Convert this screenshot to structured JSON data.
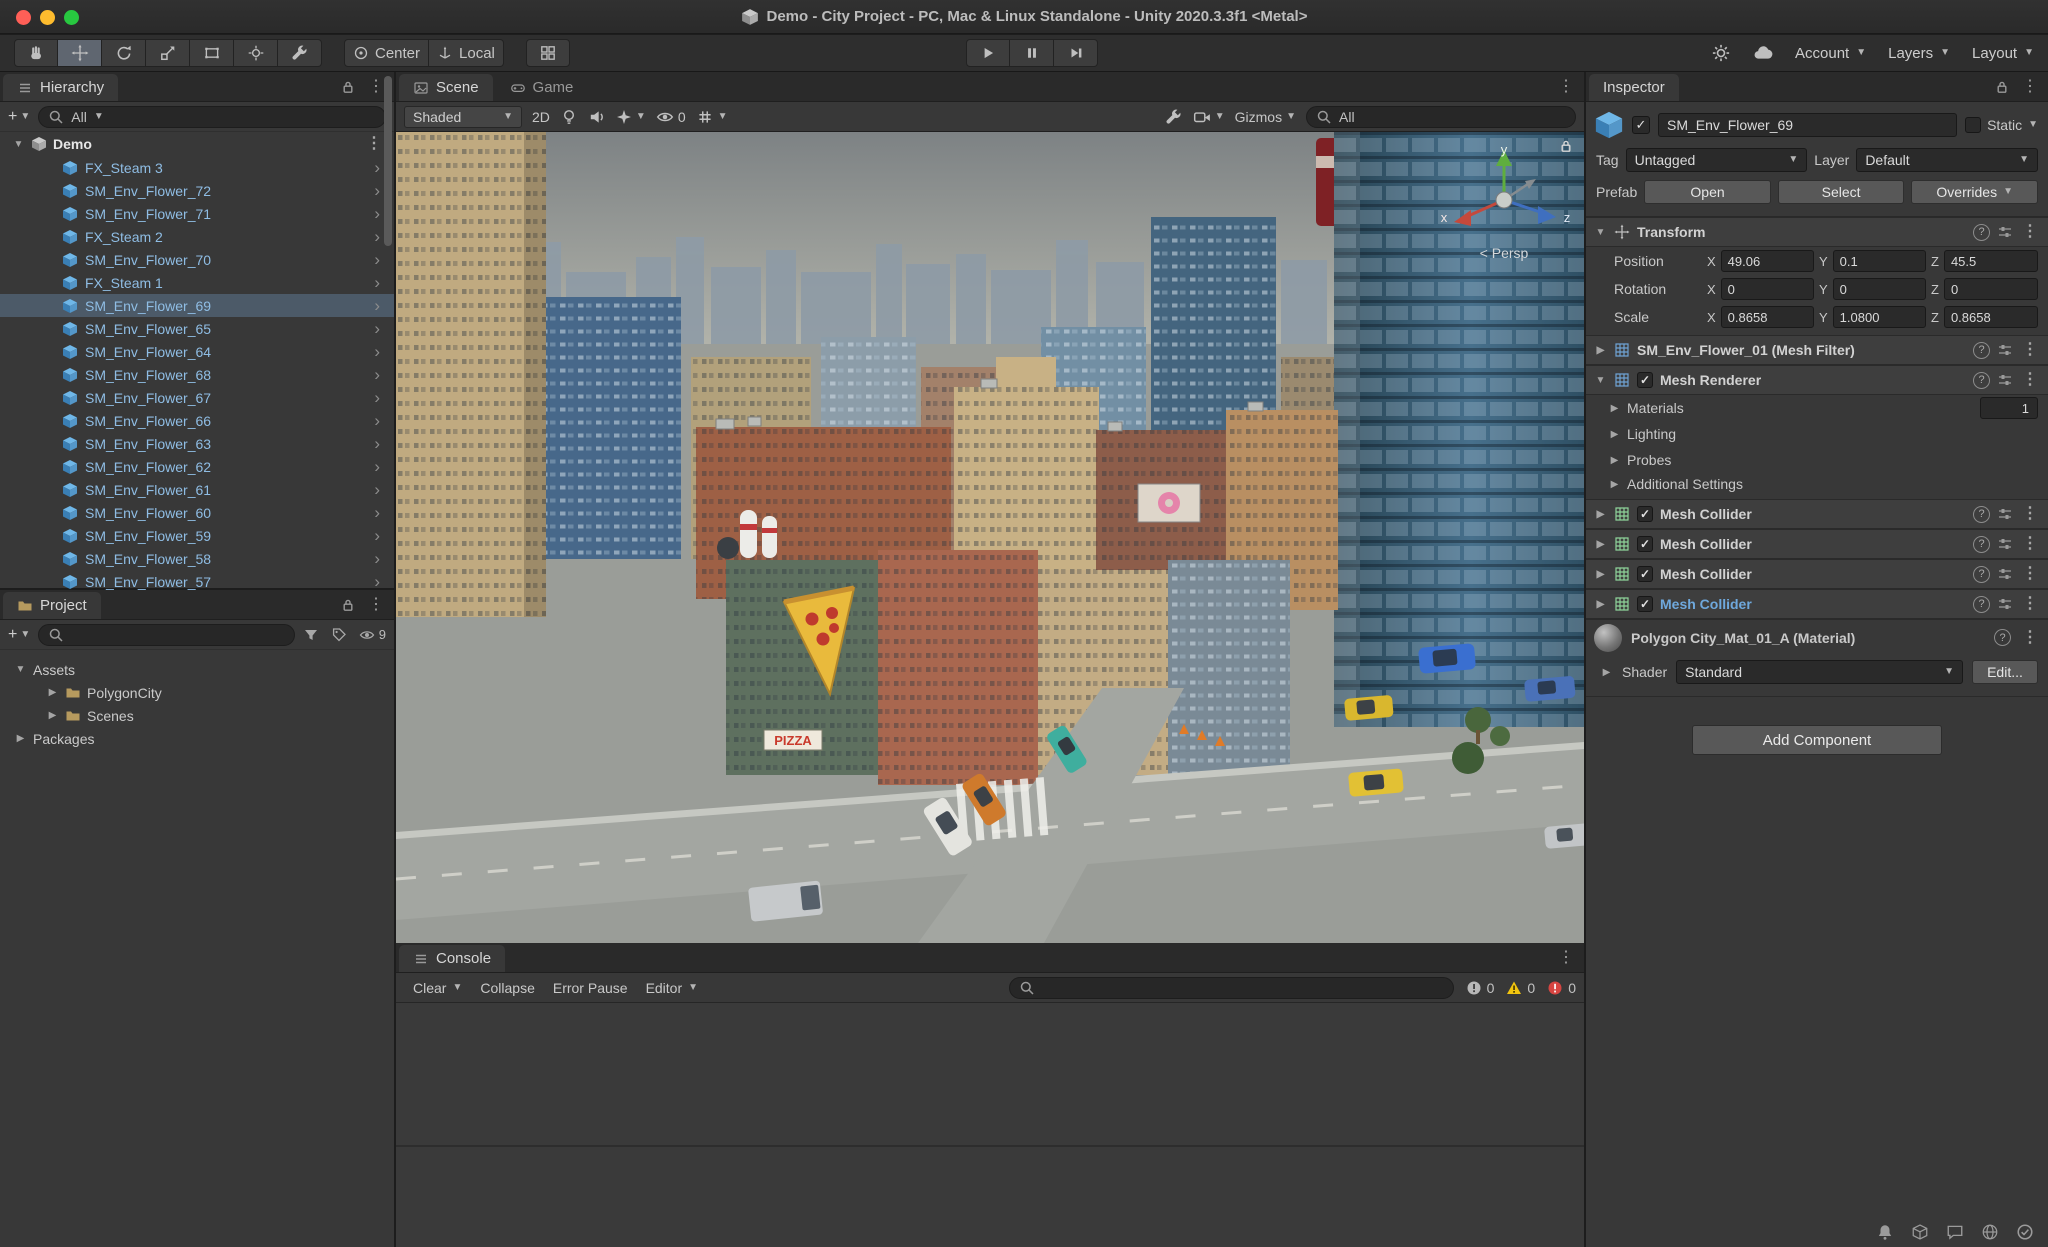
{
  "colors": {
    "selection_row": "#4c5a68",
    "prefab_text": "#8fbde4",
    "warning_yellow": "#f1c40f",
    "error_red": "#d64541",
    "panel_bg": "#383838",
    "accent_component": "#6fa8dc"
  },
  "titlebar": {
    "title": "Demo - City Project - PC, Mac & Linux Standalone - Unity 2020.3.3f1 <Metal>"
  },
  "toolbar": {
    "center_label": "Center",
    "local_label": "Local",
    "account_label": "Account",
    "layers_label": "Layers",
    "layout_label": "Layout"
  },
  "hierarchy": {
    "tab": "Hierarchy",
    "search_value": "All",
    "scene": "Demo",
    "items": [
      "FX_Steam 3",
      "SM_Env_Flower_72",
      "SM_Env_Flower_71",
      "FX_Steam 2",
      "SM_Env_Flower_70",
      "FX_Steam 1",
      "SM_Env_Flower_69",
      "SM_Env_Flower_65",
      "SM_Env_Flower_64",
      "SM_Env_Flower_68",
      "SM_Env_Flower_67",
      "SM_Env_Flower_66",
      "SM_Env_Flower_63",
      "SM_Env_Flower_62",
      "SM_Env_Flower_61",
      "SM_Env_Flower_60",
      "SM_Env_Flower_59",
      "SM_Env_Flower_58",
      "SM_Env_Flower_57"
    ]
  },
  "project": {
    "tab": "Project",
    "hidden_count": "9",
    "folders": [
      "Assets",
      "PolygonCity",
      "Scenes",
      "Packages"
    ]
  },
  "scene_view": {
    "tab_scene": "Scene",
    "tab_game": "Game",
    "draw_mode": "Shaded",
    "toggle_2d": "2D",
    "hidden_count": "0",
    "gizmos_label": "Gizmos",
    "search_value": "All",
    "pizza_sign": "PIZZA",
    "gizmo": {
      "x": "x",
      "y": "y",
      "z": "z",
      "persp": "< Persp"
    }
  },
  "console": {
    "tab": "Console",
    "clear_label": "Clear",
    "collapse_label": "Collapse",
    "error_pause_label": "Error Pause",
    "editor_label": "Editor",
    "info_count": "0",
    "warning_count": "0",
    "error_count": "0"
  },
  "inspector": {
    "tab": "Inspector",
    "object_name": "SM_Env_Flower_69",
    "static_label": "Static",
    "tag_label": "Tag",
    "tag_value": "Untagged",
    "layer_label": "Layer",
    "layer_value": "Default",
    "prefab_label": "Prefab",
    "open_label": "Open",
    "select_label": "Select",
    "overrides_label": "Overrides",
    "transform": {
      "title": "Transform",
      "axis_x": "X",
      "axis_y": "Y",
      "axis_z": "Z",
      "rows": [
        {
          "label": "Position",
          "x": "49.06",
          "y": "0.1",
          "z": "45.5"
        },
        {
          "label": "Rotation",
          "x": "0",
          "y": "0",
          "z": "0"
        },
        {
          "label": "Scale",
          "x": "0.8658",
          "y": "1.0800",
          "z": "0.8658"
        }
      ]
    },
    "mesh_filter_title": "SM_Env_Flower_01 (Mesh Filter)",
    "mesh_renderer": {
      "title": "Mesh Renderer",
      "materials_label": "Materials",
      "materials_count": "1",
      "lighting_label": "Lighting",
      "probes_label": "Probes",
      "additional_label": "Additional Settings"
    },
    "mesh_colliders": [
      "Mesh Collider",
      "Mesh Collider",
      "Mesh Collider",
      "Mesh Collider"
    ],
    "material": {
      "title": "Polygon City_Mat_01_A (Material)",
      "shader_label": "Shader",
      "shader_value": "Standard",
      "edit_label": "Edit..."
    },
    "add_component_label": "Add Component"
  }
}
